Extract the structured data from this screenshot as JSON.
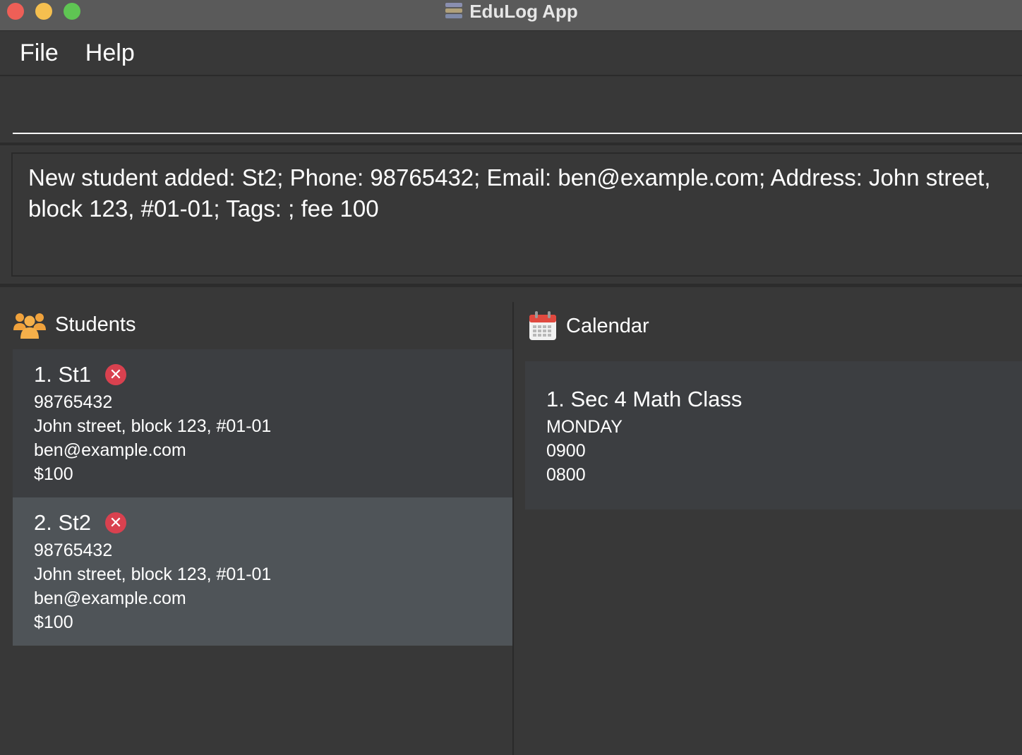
{
  "window": {
    "title": "EduLog App"
  },
  "menu": {
    "items": [
      "File",
      "Help"
    ]
  },
  "command": {
    "value": "",
    "placeholder": ""
  },
  "result": {
    "text": "New student added: St2; Phone: 98765432; Email: ben@example.com; Address: John street, block 123, #01-01; Tags: ; fee 100"
  },
  "students": {
    "header": "Students",
    "icon": "users-icon",
    "items": [
      {
        "title": "1. St1",
        "phone": "98765432",
        "address": "John street, block 123, #01-01",
        "email": "ben@example.com",
        "fee": "$100"
      },
      {
        "title": "2. St2",
        "phone": "98765432",
        "address": "John street, block 123, #01-01",
        "email": "ben@example.com",
        "fee": "$100",
        "selected": true
      }
    ]
  },
  "calendar": {
    "header": "Calendar",
    "icon": "calendar-icon",
    "items": [
      {
        "title": "1. Sec 4 Math Class",
        "day": "MONDAY",
        "start": "0900",
        "end": "0800"
      }
    ]
  },
  "colors": {
    "background": "#383838",
    "title_bar": "#5a5a5a",
    "card": "#3c3e41",
    "card_selected": "#4f5458",
    "delete_badge": "#d9414f",
    "users_icon": "#f0a23c",
    "calendar_icon": "#e0493f"
  }
}
